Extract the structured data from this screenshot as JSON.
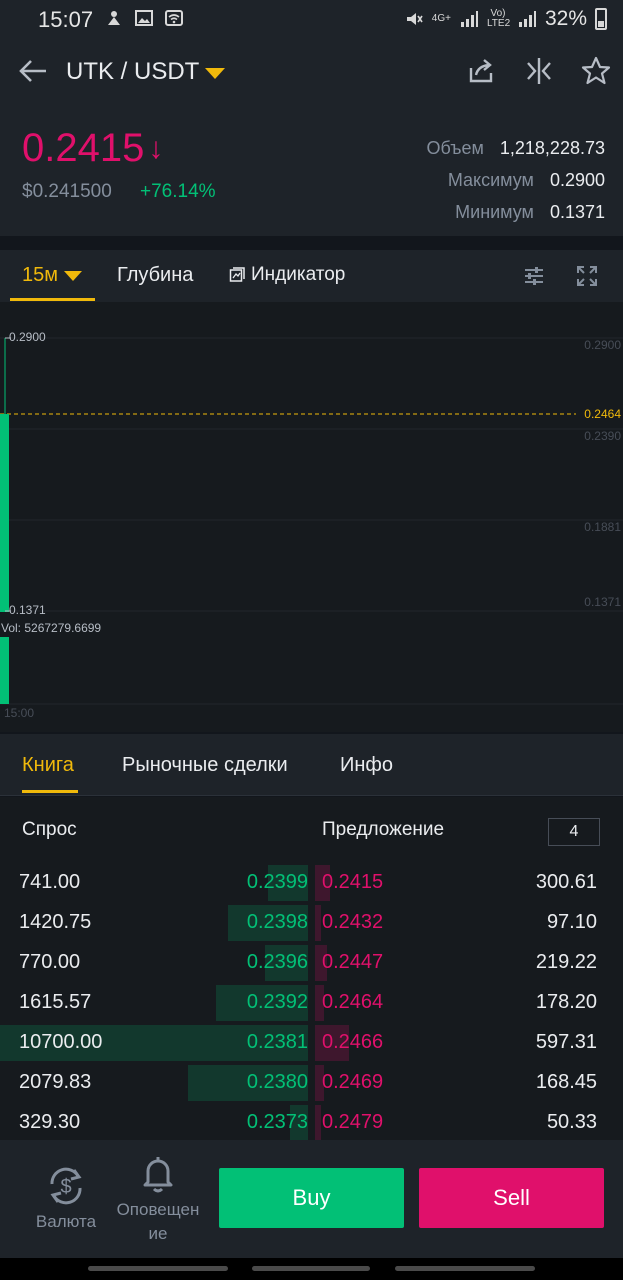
{
  "status": {
    "time": "15:07",
    "net_4g": "4G+",
    "volte": "Vo) LTE2",
    "battery": "32%"
  },
  "header": {
    "pair": "UTK / USDT",
    "price": "0.2415",
    "usd_price": "$0.241500",
    "change": "+76.14%",
    "stats": [
      {
        "label": "Объем",
        "value": "1,218,228.73"
      },
      {
        "label": "Максимум",
        "value": "0.2900"
      },
      {
        "label": "Минимум",
        "value": "0.1371"
      }
    ]
  },
  "chart_toolbar": {
    "interval": "15м",
    "depth": "Глубина",
    "indicator": "Индикатор"
  },
  "chart": {
    "y_axis_labels": [
      "0.2900",
      "0.2390",
      "0.1881",
      "0.1371"
    ],
    "last_price_label": "0.2464",
    "high_marker": "0.2900",
    "low_marker": "0.1371",
    "volume": "Vol: 5267279.6699",
    "time_label": "15:00"
  },
  "book_tabs": [
    "Книга",
    "Рыночные сделки",
    "Инфо"
  ],
  "book": {
    "bid_header": "Спрос",
    "ask_header": "Предложение",
    "depth": "4",
    "rows": [
      {
        "bid_qty": "741.00",
        "bid_price": "0.2399",
        "ask_price": "0.2415",
        "ask_qty": "300.61",
        "bid_depth": 0.13,
        "ask_depth": 0.05
      },
      {
        "bid_qty": "1420.75",
        "bid_price": "0.2398",
        "ask_price": "0.2432",
        "ask_qty": "97.10",
        "bid_depth": 0.26,
        "ask_depth": 0.02
      },
      {
        "bid_qty": "770.00",
        "bid_price": "0.2396",
        "ask_price": "0.2447",
        "ask_qty": "219.22",
        "bid_depth": 0.14,
        "ask_depth": 0.04
      },
      {
        "bid_qty": "1615.57",
        "bid_price": "0.2392",
        "ask_price": "0.2464",
        "ask_qty": "178.20",
        "bid_depth": 0.3,
        "ask_depth": 0.03
      },
      {
        "bid_qty": "10700.00",
        "bid_price": "0.2381",
        "ask_price": "0.2466",
        "ask_qty": "597.31",
        "bid_depth": 1.0,
        "ask_depth": 0.11
      },
      {
        "bid_qty": "2079.83",
        "bid_price": "0.2380",
        "ask_price": "0.2469",
        "ask_qty": "168.45",
        "bid_depth": 0.39,
        "ask_depth": 0.03
      },
      {
        "bid_qty": "329.30",
        "bid_price": "0.2373",
        "ask_price": "0.2479",
        "ask_qty": "50.33",
        "bid_depth": 0.06,
        "ask_depth": 0.01
      }
    ]
  },
  "bottom": {
    "currency": "Валюта",
    "alerts_line1": "Оповещен",
    "alerts_line2": "ие",
    "buy": "Buy",
    "sell": "Sell"
  },
  "colors": {
    "up": "#02c076",
    "down": "#e0106b",
    "accent": "#f0b90b"
  }
}
